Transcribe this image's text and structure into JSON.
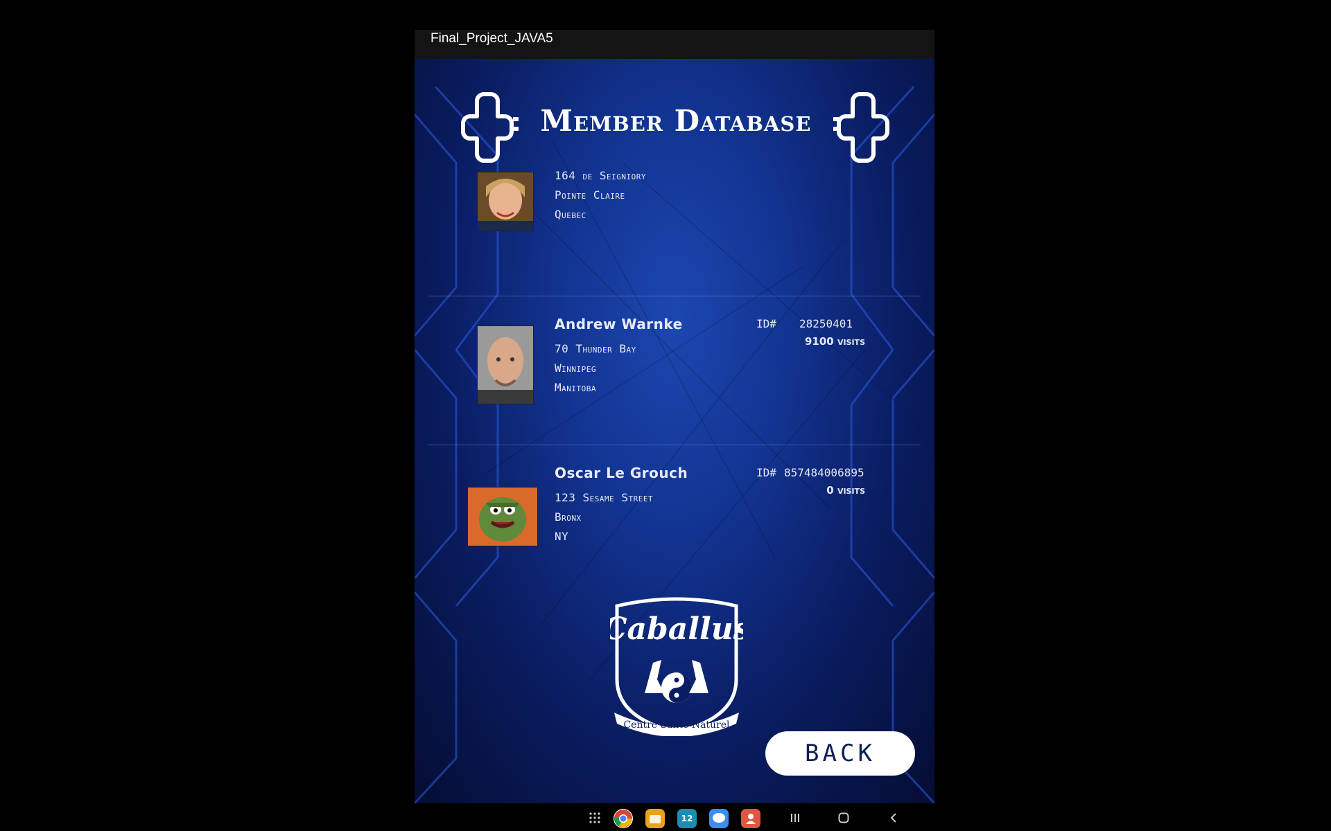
{
  "window": {
    "title": "Final_Project_JAVA5"
  },
  "header": {
    "title": "Member Database"
  },
  "members": [
    {
      "name": "",
      "address": [
        "164 de Seigniory",
        "Pointe Claire",
        "Quebec"
      ],
      "id_label": "",
      "id": "",
      "visits": ""
    },
    {
      "name": "Andrew Warnke",
      "address": [
        "70 Thunder Bay",
        "Winnipeg",
        "Manitoba"
      ],
      "id_label": "ID#",
      "id": "28250401",
      "visits": "9100 visits"
    },
    {
      "name": "Oscar Le Grouch",
      "address": [
        "123 Sesame Street",
        "Bronx",
        "NY"
      ],
      "id_label": "ID#",
      "id": "857484006895",
      "visits": "0 visits"
    }
  ],
  "logo": {
    "name": "Caballus",
    "tagline": "Centre Santé Naturel"
  },
  "buttons": {
    "back": "BACK"
  },
  "navbar": {
    "icons": [
      "apps-grid-icon",
      "chrome-icon",
      "files-icon",
      "calendar-icon",
      "messages-icon",
      "contacts-icon",
      "recents-icon",
      "home-icon",
      "back-nav-icon"
    ],
    "calendar_day": "12"
  },
  "colors": {
    "background": "#06113a",
    "accent": "#123390",
    "button_text": "#0f1e55"
  }
}
